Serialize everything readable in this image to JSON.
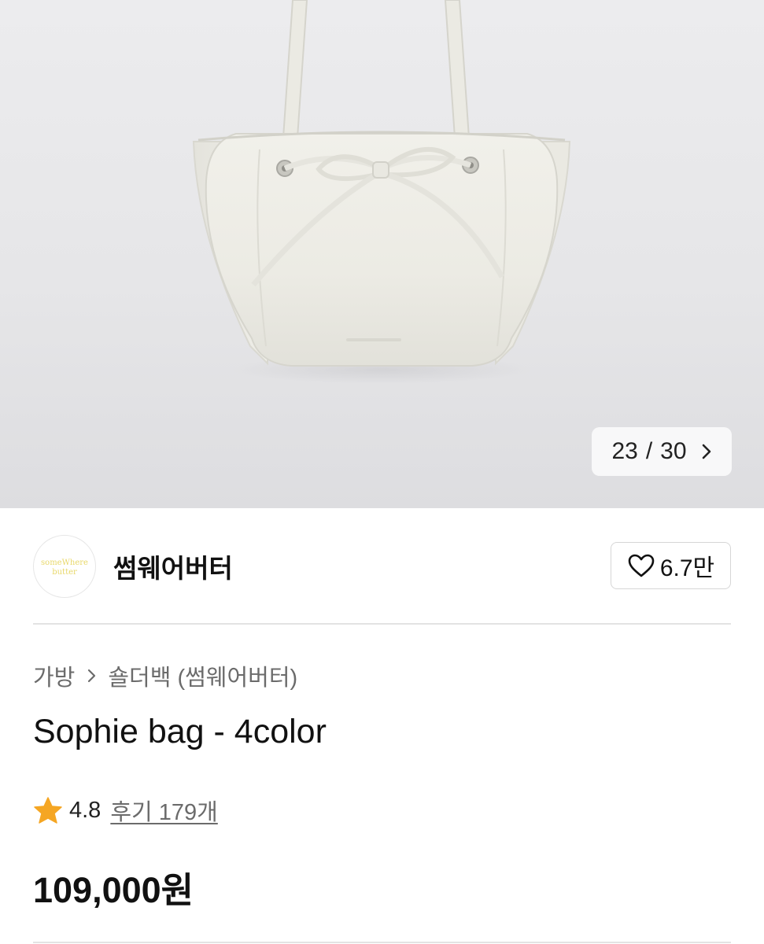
{
  "gallery": {
    "current": "23",
    "separator": "/",
    "total": "30",
    "next_icon": "chevron-right-icon",
    "image_alt_icon": "product-photo-bag"
  },
  "seller": {
    "logo_text": "someWhere butter",
    "name": "썸웨어버터",
    "like_icon": "heart-outline-icon",
    "like_count": "6.7만"
  },
  "breadcrumb": {
    "category": "가방",
    "subcategory": "숄더백 (썸웨어버터)"
  },
  "product": {
    "title": "Sophie bag - 4color",
    "rating_icon": "star-icon",
    "rating": "4.8",
    "reviews": "후기 179개",
    "price": "109,000원"
  },
  "colors": {
    "star": "#f5a623",
    "logo_text": "#e8d86a",
    "text_primary": "#111111",
    "text_secondary": "#6b6b6b"
  }
}
